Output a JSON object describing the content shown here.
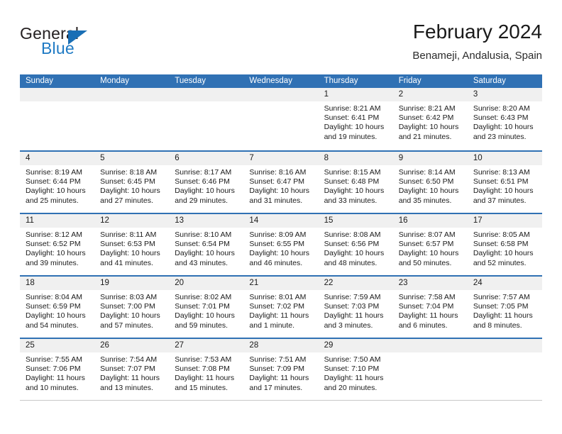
{
  "brand": {
    "word1": "General",
    "word2": "Blue",
    "triangle_icon": "triangle-icon",
    "color_dark": "#231f20",
    "color_blue": "#1f7ac4"
  },
  "header": {
    "title": "February 2024",
    "subtitle": "Benameji, Andalusia, Spain"
  },
  "theme": {
    "header_blue": "#3071b4",
    "daynumber_gray": "#f0f0f0",
    "text": "#1a1a1a"
  },
  "weekdays": [
    "Sunday",
    "Monday",
    "Tuesday",
    "Wednesday",
    "Thursday",
    "Friday",
    "Saturday"
  ],
  "weeks": [
    [
      {
        "day": "",
        "lines": []
      },
      {
        "day": "",
        "lines": []
      },
      {
        "day": "",
        "lines": []
      },
      {
        "day": "",
        "lines": []
      },
      {
        "day": "1",
        "lines": [
          "Sunrise: 8:21 AM",
          "Sunset: 6:41 PM",
          "Daylight: 10 hours",
          "and 19 minutes."
        ]
      },
      {
        "day": "2",
        "lines": [
          "Sunrise: 8:21 AM",
          "Sunset: 6:42 PM",
          "Daylight: 10 hours",
          "and 21 minutes."
        ]
      },
      {
        "day": "3",
        "lines": [
          "Sunrise: 8:20 AM",
          "Sunset: 6:43 PM",
          "Daylight: 10 hours",
          "and 23 minutes."
        ]
      }
    ],
    [
      {
        "day": "4",
        "lines": [
          "Sunrise: 8:19 AM",
          "Sunset: 6:44 PM",
          "Daylight: 10 hours",
          "and 25 minutes."
        ]
      },
      {
        "day": "5",
        "lines": [
          "Sunrise: 8:18 AM",
          "Sunset: 6:45 PM",
          "Daylight: 10 hours",
          "and 27 minutes."
        ]
      },
      {
        "day": "6",
        "lines": [
          "Sunrise: 8:17 AM",
          "Sunset: 6:46 PM",
          "Daylight: 10 hours",
          "and 29 minutes."
        ]
      },
      {
        "day": "7",
        "lines": [
          "Sunrise: 8:16 AM",
          "Sunset: 6:47 PM",
          "Daylight: 10 hours",
          "and 31 minutes."
        ]
      },
      {
        "day": "8",
        "lines": [
          "Sunrise: 8:15 AM",
          "Sunset: 6:48 PM",
          "Daylight: 10 hours",
          "and 33 minutes."
        ]
      },
      {
        "day": "9",
        "lines": [
          "Sunrise: 8:14 AM",
          "Sunset: 6:50 PM",
          "Daylight: 10 hours",
          "and 35 minutes."
        ]
      },
      {
        "day": "10",
        "lines": [
          "Sunrise: 8:13 AM",
          "Sunset: 6:51 PM",
          "Daylight: 10 hours",
          "and 37 minutes."
        ]
      }
    ],
    [
      {
        "day": "11",
        "lines": [
          "Sunrise: 8:12 AM",
          "Sunset: 6:52 PM",
          "Daylight: 10 hours",
          "and 39 minutes."
        ]
      },
      {
        "day": "12",
        "lines": [
          "Sunrise: 8:11 AM",
          "Sunset: 6:53 PM",
          "Daylight: 10 hours",
          "and 41 minutes."
        ]
      },
      {
        "day": "13",
        "lines": [
          "Sunrise: 8:10 AM",
          "Sunset: 6:54 PM",
          "Daylight: 10 hours",
          "and 43 minutes."
        ]
      },
      {
        "day": "14",
        "lines": [
          "Sunrise: 8:09 AM",
          "Sunset: 6:55 PM",
          "Daylight: 10 hours",
          "and 46 minutes."
        ]
      },
      {
        "day": "15",
        "lines": [
          "Sunrise: 8:08 AM",
          "Sunset: 6:56 PM",
          "Daylight: 10 hours",
          "and 48 minutes."
        ]
      },
      {
        "day": "16",
        "lines": [
          "Sunrise: 8:07 AM",
          "Sunset: 6:57 PM",
          "Daylight: 10 hours",
          "and 50 minutes."
        ]
      },
      {
        "day": "17",
        "lines": [
          "Sunrise: 8:05 AM",
          "Sunset: 6:58 PM",
          "Daylight: 10 hours",
          "and 52 minutes."
        ]
      }
    ],
    [
      {
        "day": "18",
        "lines": [
          "Sunrise: 8:04 AM",
          "Sunset: 6:59 PM",
          "Daylight: 10 hours",
          "and 54 minutes."
        ]
      },
      {
        "day": "19",
        "lines": [
          "Sunrise: 8:03 AM",
          "Sunset: 7:00 PM",
          "Daylight: 10 hours",
          "and 57 minutes."
        ]
      },
      {
        "day": "20",
        "lines": [
          "Sunrise: 8:02 AM",
          "Sunset: 7:01 PM",
          "Daylight: 10 hours",
          "and 59 minutes."
        ]
      },
      {
        "day": "21",
        "lines": [
          "Sunrise: 8:01 AM",
          "Sunset: 7:02 PM",
          "Daylight: 11 hours",
          "and 1 minute."
        ]
      },
      {
        "day": "22",
        "lines": [
          "Sunrise: 7:59 AM",
          "Sunset: 7:03 PM",
          "Daylight: 11 hours",
          "and 3 minutes."
        ]
      },
      {
        "day": "23",
        "lines": [
          "Sunrise: 7:58 AM",
          "Sunset: 7:04 PM",
          "Daylight: 11 hours",
          "and 6 minutes."
        ]
      },
      {
        "day": "24",
        "lines": [
          "Sunrise: 7:57 AM",
          "Sunset: 7:05 PM",
          "Daylight: 11 hours",
          "and 8 minutes."
        ]
      }
    ],
    [
      {
        "day": "25",
        "lines": [
          "Sunrise: 7:55 AM",
          "Sunset: 7:06 PM",
          "Daylight: 11 hours",
          "and 10 minutes."
        ]
      },
      {
        "day": "26",
        "lines": [
          "Sunrise: 7:54 AM",
          "Sunset: 7:07 PM",
          "Daylight: 11 hours",
          "and 13 minutes."
        ]
      },
      {
        "day": "27",
        "lines": [
          "Sunrise: 7:53 AM",
          "Sunset: 7:08 PM",
          "Daylight: 11 hours",
          "and 15 minutes."
        ]
      },
      {
        "day": "28",
        "lines": [
          "Sunrise: 7:51 AM",
          "Sunset: 7:09 PM",
          "Daylight: 11 hours",
          "and 17 minutes."
        ]
      },
      {
        "day": "29",
        "lines": [
          "Sunrise: 7:50 AM",
          "Sunset: 7:10 PM",
          "Daylight: 11 hours",
          "and 20 minutes."
        ]
      },
      {
        "day": "",
        "lines": []
      },
      {
        "day": "",
        "lines": []
      }
    ]
  ]
}
